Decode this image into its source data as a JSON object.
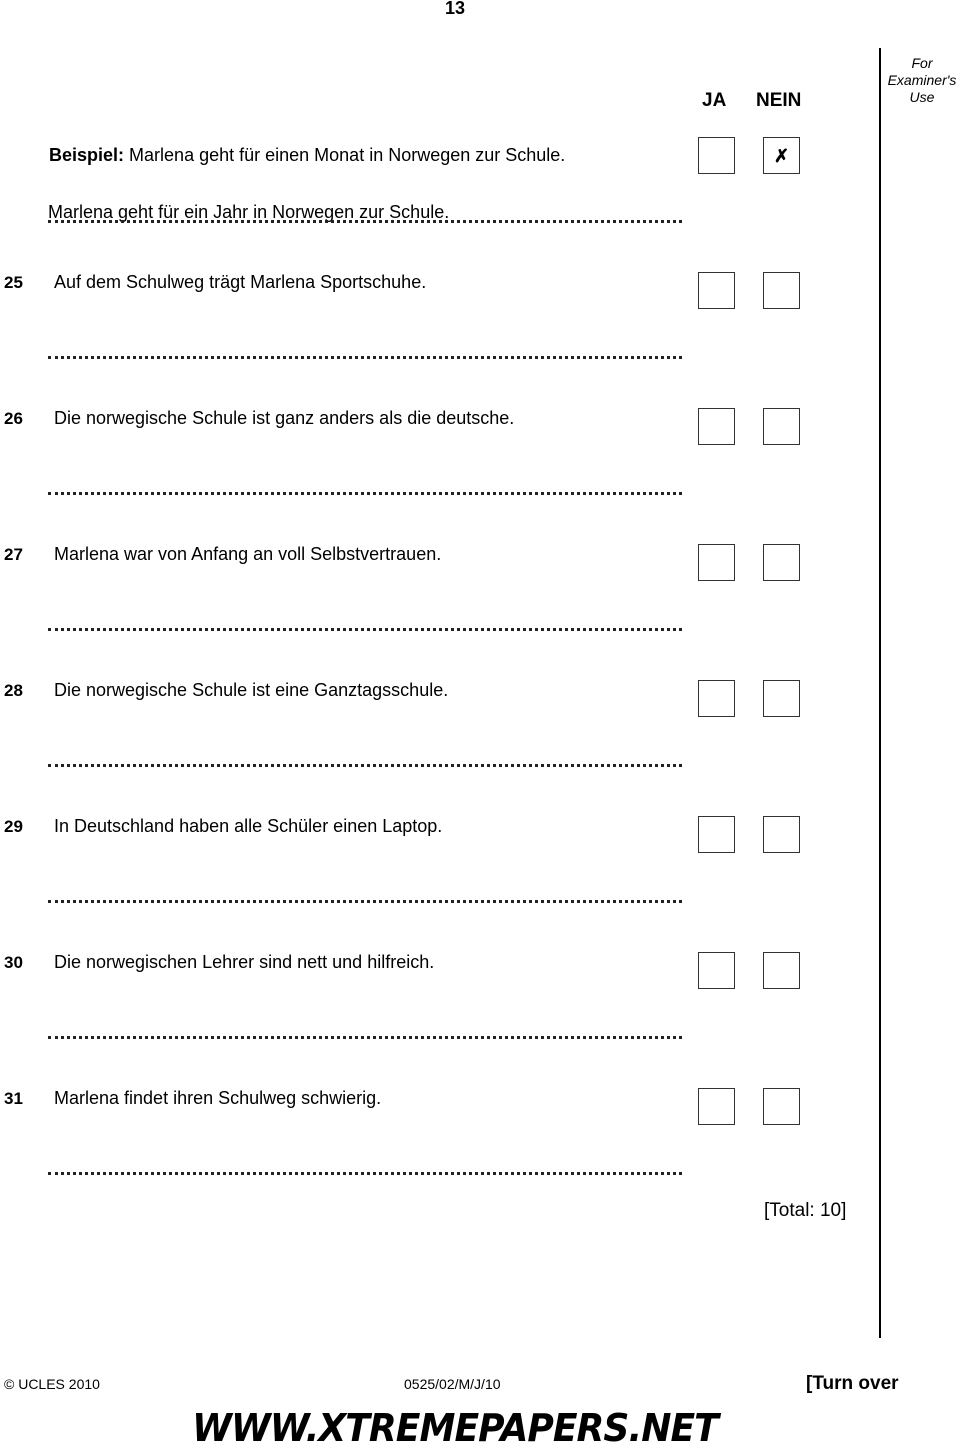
{
  "page_number": "13",
  "columns": {
    "yes": "JA",
    "no": "NEIN"
  },
  "examiner_use": "For Examiner's Use",
  "example": {
    "label": "Beispiel:",
    "statement": "Marlena geht für einen Monat in Norwegen zur Schule.",
    "answer_yes": "",
    "answer_no": "✗",
    "correction": "Marlena geht für ein Jahr in Norwegen zur Schule."
  },
  "questions": [
    {
      "number": "25",
      "text": "Auf dem Schulweg trägt Marlena Sportschuhe."
    },
    {
      "number": "26",
      "text": "Die norwegische Schule ist ganz anders als die deutsche."
    },
    {
      "number": "27",
      "text": "Marlena war von Anfang an voll Selbstvertrauen."
    },
    {
      "number": "28",
      "text": "Die norwegische Schule ist eine Ganztagsschule."
    },
    {
      "number": "29",
      "text": "In Deutschland haben alle Schüler einen Laptop."
    },
    {
      "number": "30",
      "text": "Die norwegischen Lehrer sind nett und hilfreich."
    },
    {
      "number": "31",
      "text": "Marlena findet ihren Schulweg schwierig."
    }
  ],
  "total": "[Total: 10]",
  "footer": {
    "copyright": "© UCLES 2010",
    "code": "0525/02/M/J/10",
    "turn_over": "[Turn over",
    "watermark": "WWW.XTREMEPAPERS.NET"
  }
}
